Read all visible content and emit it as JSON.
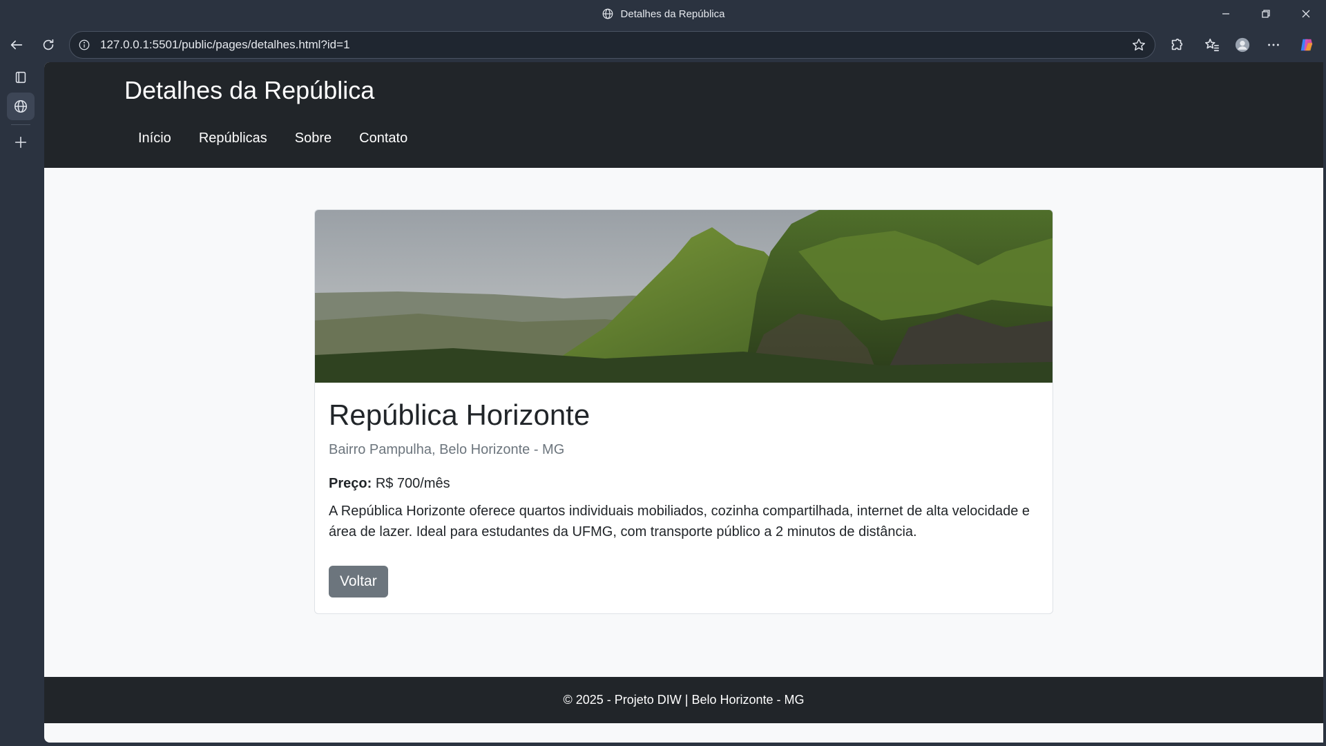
{
  "window": {
    "title": "Detalhes da República"
  },
  "browser": {
    "url": "127.0.0.1:5501/public/pages/detalhes.html?id=1"
  },
  "page": {
    "header": {
      "title": "Detalhes da República",
      "nav": [
        "Início",
        "Repúblicas",
        "Sobre",
        "Contato"
      ]
    },
    "card": {
      "title": "República Horizonte",
      "subtitle": "Bairro Pampulha, Belo Horizonte - MG",
      "price_label": "Preço:",
      "price_value": "R$ 700/mês",
      "description": "A República Horizonte oferece quartos individuais mobiliados, cozinha compartilhada, internet de alta velocidade e área de lazer. Ideal para estudantes da UFMG, com transporte público a 2 minutos de distância.",
      "back_button": "Voltar"
    },
    "footer": {
      "text": "© 2025 - Projeto DIW | Belo Horizonte - MG"
    }
  },
  "colors": {
    "header_bg": "#212529",
    "page_bg": "#f8f9fa",
    "button_bg": "#6c757d",
    "chrome_bg": "#2b3340"
  }
}
